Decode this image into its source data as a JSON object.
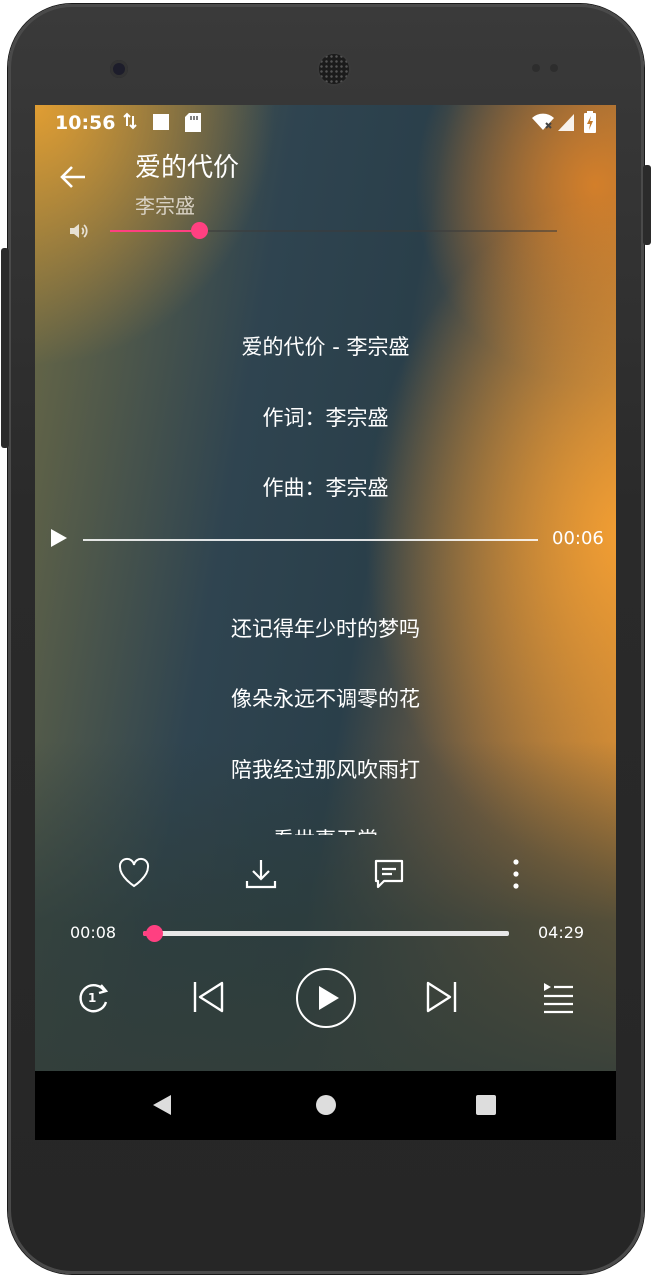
{
  "status_bar": {
    "time": "10:56",
    "icons": [
      "data-transfer-icon",
      "notification-square-icon",
      "sd-card-icon",
      "wifi-icon",
      "signal-icon",
      "battery-charging-icon"
    ]
  },
  "header": {
    "title": "爱的代价",
    "artist": "李宗盛",
    "back_icon": "back-arrow-icon"
  },
  "volume": {
    "icon": "volume-icon",
    "level": 0.2,
    "accent_color": "#ff4081"
  },
  "lyrics": {
    "lines_before": [
      "爱的代价 - 李宗盛",
      "作词：李宗盛",
      "作曲：李宗盛"
    ],
    "seek_indicator": {
      "time": "00:06"
    },
    "lines_after": [
      "还记得年少时的梦吗",
      "像朵永远不调零的花",
      "陪我经过那风吹雨打",
      "看世事无常"
    ]
  },
  "actions": {
    "items": [
      "favorite-heart-icon",
      "download-icon",
      "comment-icon",
      "more-options-icon"
    ]
  },
  "progress": {
    "current_time": "00:08",
    "total_time": "04:29",
    "fraction": 0.03
  },
  "controls": {
    "items": [
      "repeat-one-icon",
      "previous-track-icon",
      "play-icon",
      "next-track-icon",
      "playlist-icon"
    ]
  },
  "system_nav": {
    "items": [
      "nav-back-icon",
      "nav-home-icon",
      "nav-recents-icon"
    ]
  }
}
